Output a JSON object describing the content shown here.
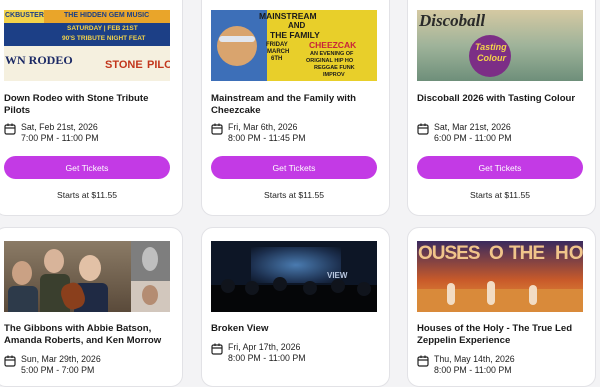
{
  "colors": {
    "accent": "#c33ae5",
    "page_bg": "#f3f3f5",
    "card_border": "#e2e2e6"
  },
  "events": [
    {
      "title": "Down Rodeo with Stone Tribute Pilots",
      "date": "Sat, Feb 21st, 2026",
      "time": "7:00 PM - 11:00 PM",
      "button": "Get Tickets",
      "price": "Starts at $11.55",
      "image_text": [
        "CKBUSTER",
        "THE HIDDEN GEM MUSIC",
        "SATURDAY | FEB 21ST",
        "90'S TRIBUTE NIGHT FEAT",
        "WN RODEO",
        "STONE",
        "PILO"
      ]
    },
    {
      "title": "Mainstream and the Family with Cheezcake",
      "date": "Fri, Mar 6th, 2026",
      "time": "8:00 PM - 11:45 PM",
      "button": "Get Tickets",
      "price": "Starts at $11.55",
      "image_text": [
        "MAINSTREAM",
        "AND",
        "THE FAMILY",
        "FRIDAY",
        "MARCH",
        "6TH",
        "CHEEZCAK",
        "AN EVENING OF",
        "ORIGINAL HIP HO",
        "REGGAE FUNK",
        "IMPROV"
      ]
    },
    {
      "title": "Discoball 2026 with Tasting Colour",
      "date": "Sat, Mar 21st, 2026",
      "time": "6:00 PM - 11:00 PM",
      "button": "Get Tickets",
      "price": "Starts at $11.55",
      "image_text": [
        "Discoball",
        "Tasting",
        "Colour"
      ]
    },
    {
      "title": "The Gibbons with Abbie Batson, Amanda Roberts, and Ken Morrow",
      "date": "Sun, Mar 29th, 2026",
      "time": "5:00 PM - 7:00 PM"
    },
    {
      "title": "Broken View",
      "date": "Fri, Apr 17th, 2026",
      "time": "8:00 PM - 11:00 PM",
      "image_text": [
        "VIEW"
      ]
    },
    {
      "title": "Houses of the Holy - The True Led Zeppelin Experience",
      "date": "Thu, May 14th, 2026",
      "time": "8:00 PM - 11:00 PM",
      "image_text": [
        "OUSES",
        "O",
        "THE",
        "HO"
      ]
    }
  ]
}
